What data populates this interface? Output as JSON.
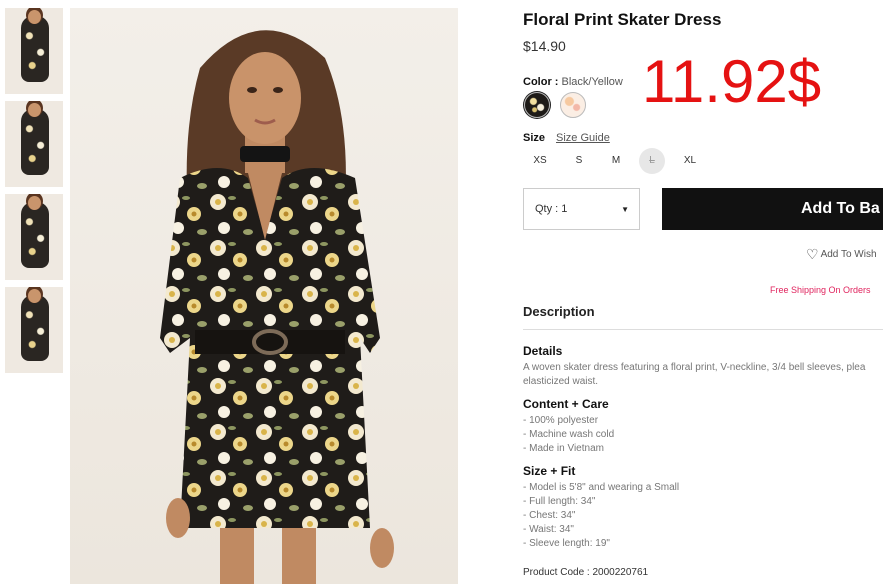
{
  "product": {
    "title": "Floral Print Skater Dress",
    "price": "$14.90",
    "color_label": "Color :",
    "color_value": "Black/Yellow",
    "promo_price": "11.92$"
  },
  "sizes": {
    "label": "Size",
    "guide": "Size Guide",
    "options": [
      "XS",
      "S",
      "M",
      "L",
      "XL"
    ],
    "unavailable": "L"
  },
  "purchase": {
    "qty_label": "Qty : 1",
    "add_button": "Add To Ba",
    "wishlist": "Add To Wish",
    "shipping": "Free Shipping On Orders"
  },
  "description": {
    "heading": "Description",
    "details_heading": "Details",
    "details_lines": [
      "A woven skater dress featuring a floral print, V-neckline, 3/4 bell sleeves, plea",
      "elasticized waist."
    ],
    "content_heading": "Content + Care",
    "content_items": [
      "- 100% polyester",
      "- Machine wash cold",
      "- Made in Vietnam"
    ],
    "fit_heading": "Size + Fit",
    "fit_items": [
      "- Model is 5'8\" and wearing a Small",
      "- Full length: 34\"",
      "- Chest: 34\"",
      "- Waist: 34\"",
      "- Sleeve length: 19\""
    ],
    "product_code": "Product Code : 2000220761"
  },
  "icons": {
    "wishlist": "heart-icon",
    "qty": "caret-down-icon"
  },
  "colors": {
    "promo": "#e51212",
    "shipping": "#e0245e",
    "button": "#111111"
  }
}
